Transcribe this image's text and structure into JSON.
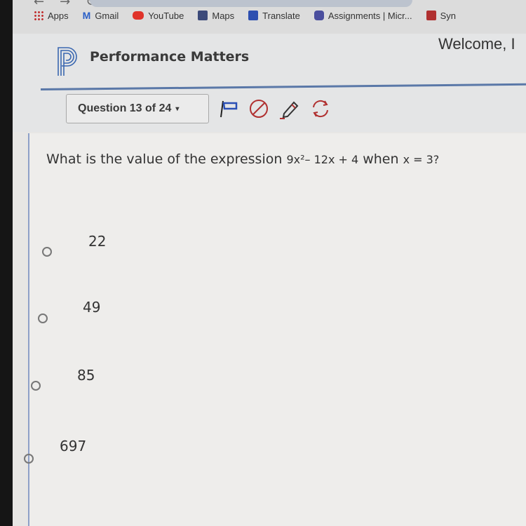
{
  "browser": {
    "bookmarks": [
      {
        "label": "Apps",
        "icon": "apps-grid-icon",
        "color": "#c03030"
      },
      {
        "label": "Gmail",
        "icon": "gmail-icon",
        "color": "#2a5fc7"
      },
      {
        "label": "YouTube",
        "icon": "youtube-icon",
        "color": "#e0332a"
      },
      {
        "label": "Maps",
        "icon": "maps-icon",
        "color": "#3c4a7a"
      },
      {
        "label": "Translate",
        "icon": "translate-icon",
        "color": "#2d4fb0"
      },
      {
        "label": "Assignments | Micr...",
        "icon": "teams-icon",
        "color": "#4b4f9e"
      },
      {
        "label": "Syn",
        "icon": "bookmark-icon",
        "color": "#b03030"
      }
    ]
  },
  "header": {
    "brand": "Performance Matters",
    "welcome": "Welcome, I",
    "brand_color": "#3a67b0"
  },
  "toolbar": {
    "question_selector": "Question 13 of 24",
    "tools": [
      {
        "name": "flag",
        "icon": "flag-icon",
        "color": "#2a4fb5"
      },
      {
        "name": "eliminate",
        "icon": "no-entry-icon",
        "color": "#b03030"
      },
      {
        "name": "highlight",
        "icon": "pencil-icon",
        "color": "#b03030"
      },
      {
        "name": "reset",
        "icon": "refresh-icon",
        "color": "#b03030"
      }
    ]
  },
  "question": {
    "prefix": "What is the value of the expression ",
    "expression": "9x²– 12x + 4",
    "middle": " when ",
    "condition": "x = 3?",
    "options": [
      {
        "label": "22",
        "selected": false
      },
      {
        "label": "49",
        "selected": false
      },
      {
        "label": "85",
        "selected": false
      },
      {
        "label": "697",
        "selected": false
      }
    ]
  }
}
